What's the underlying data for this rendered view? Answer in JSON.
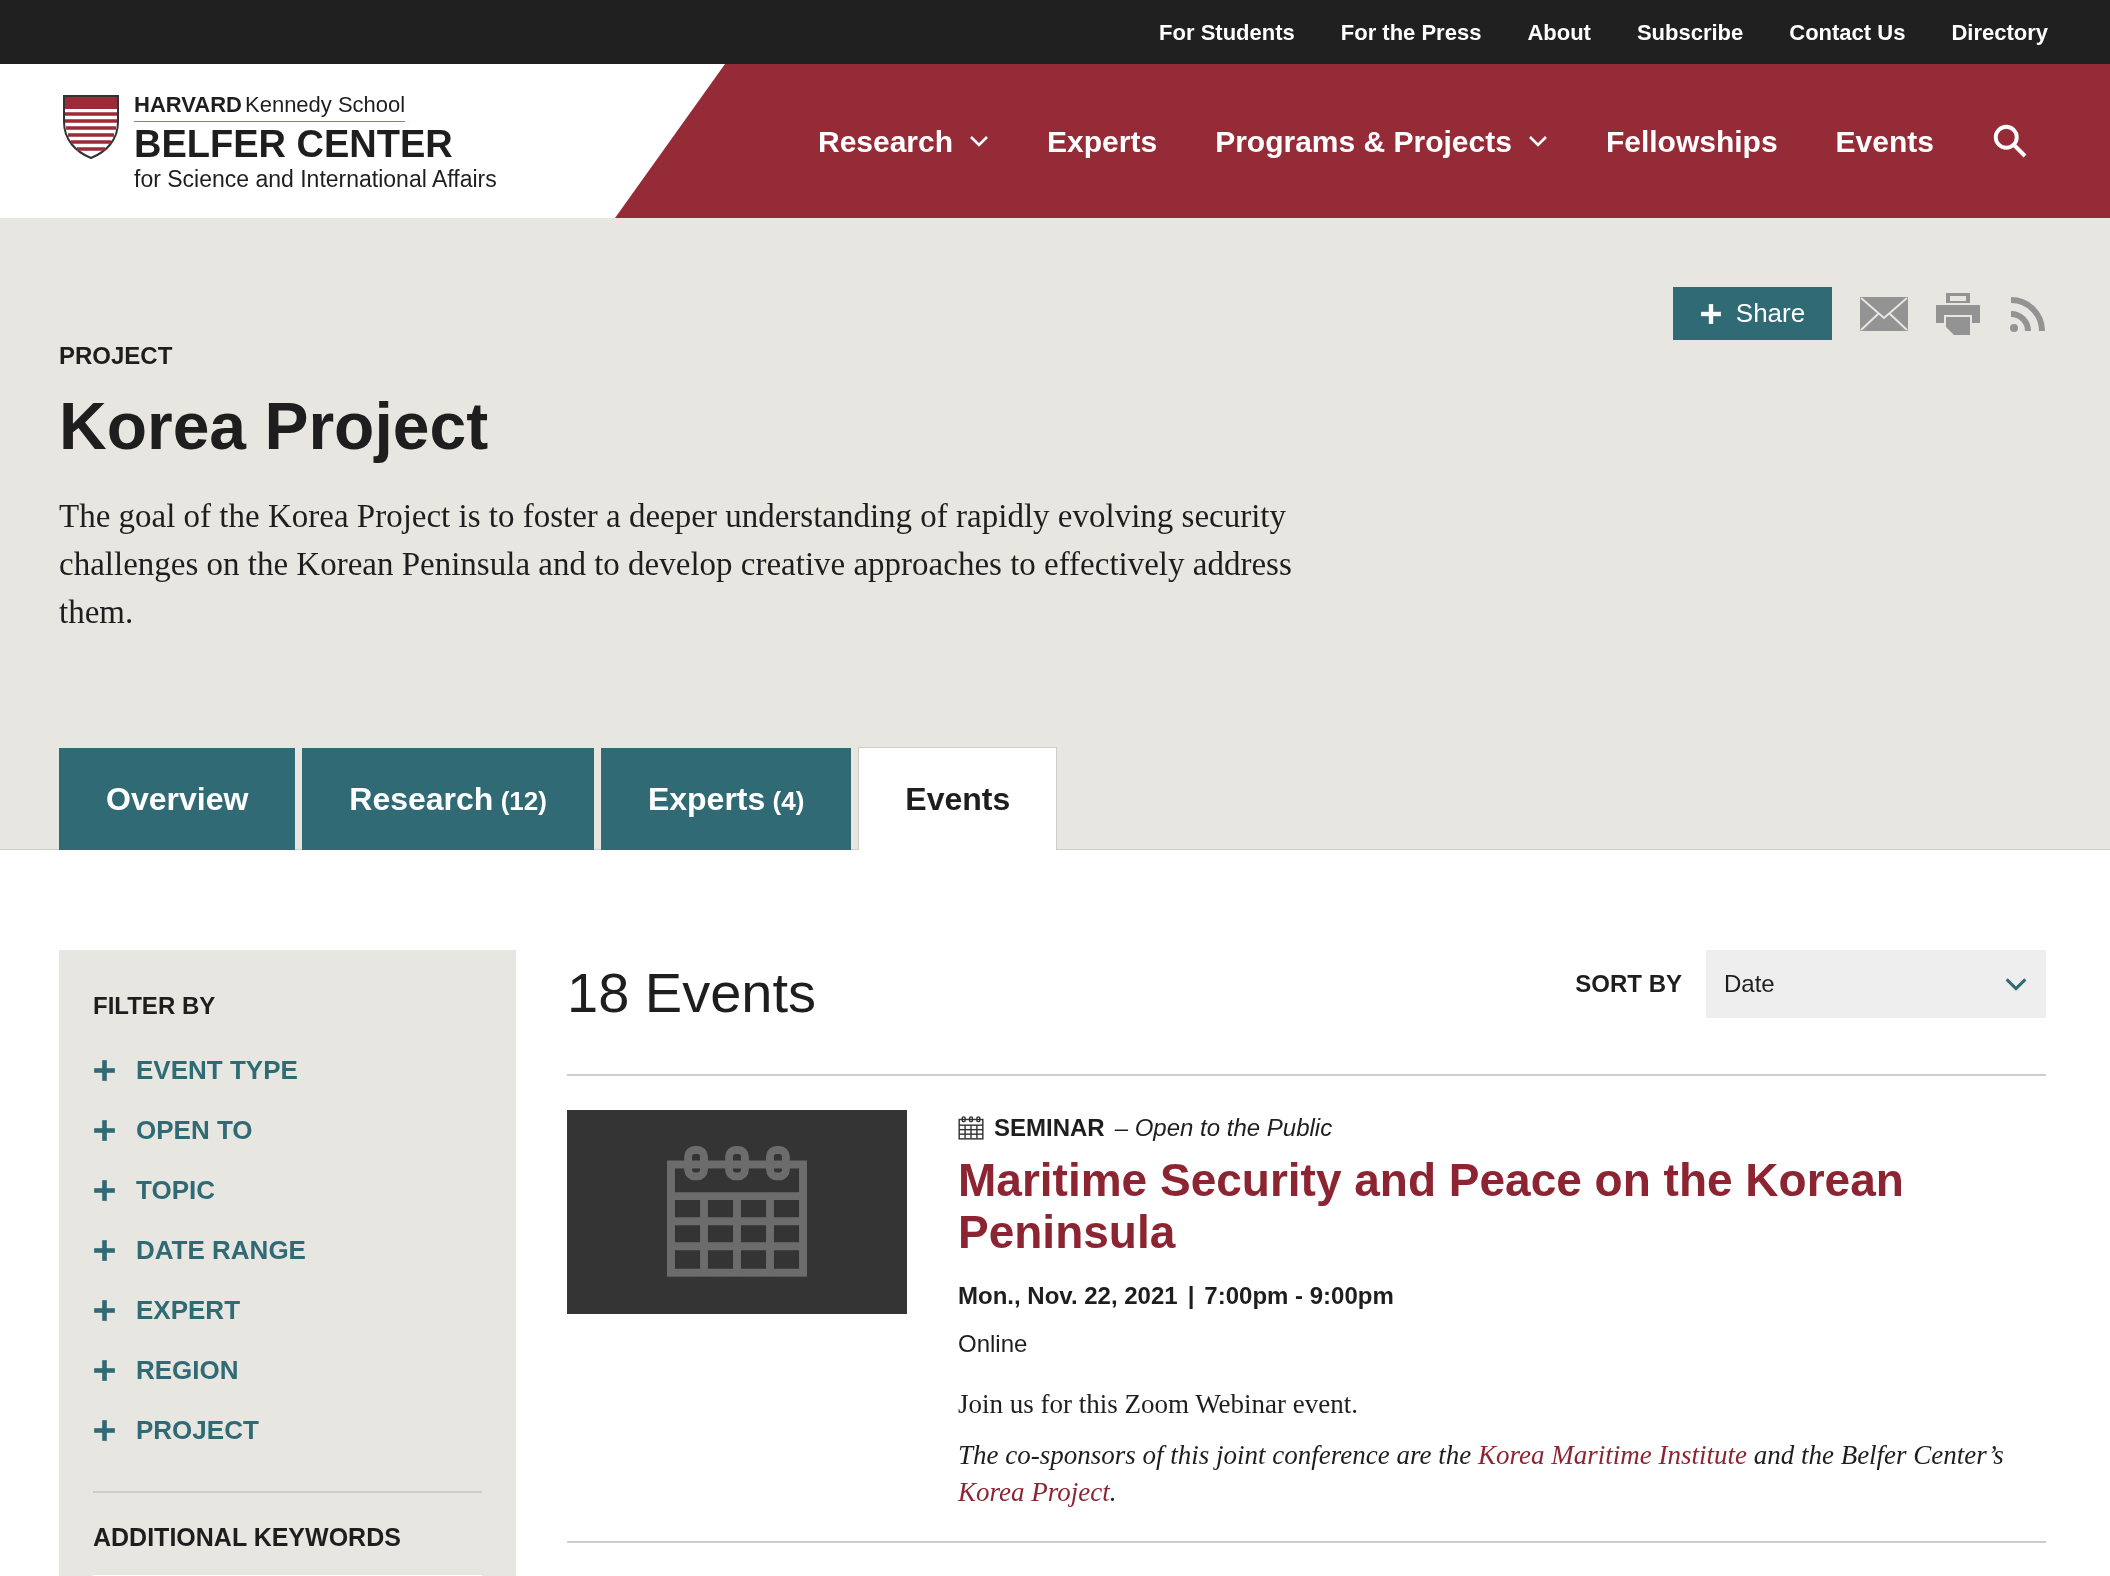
{
  "top_links": [
    "For Students",
    "For the Press",
    "About",
    "Subscribe",
    "Contact Us",
    "Directory"
  ],
  "logo": {
    "line_1_bold": "HARVARD",
    "line_1_rest": "Kennedy School",
    "line_2": "BELFER CENTER",
    "line_3": "for Science and International Affairs"
  },
  "main_nav": [
    {
      "label": "Research",
      "has_menu": true
    },
    {
      "label": "Experts",
      "has_menu": false
    },
    {
      "label": "Programs & Projects",
      "has_menu": true
    },
    {
      "label": "Fellowships",
      "has_menu": false
    },
    {
      "label": "Events",
      "has_menu": false
    }
  ],
  "share_button": "Share",
  "eyebrow": "PROJECT",
  "title": "Korea Project",
  "description": "The goal of the Korea Project is to foster a deeper understanding of rapidly evolving security challenges on the Korean Peninsula and to develop creative approaches to effectively address them.",
  "tabs": [
    {
      "label": "Overview",
      "selected": false
    },
    {
      "label": "Research",
      "count": "(12)",
      "selected": false
    },
    {
      "label": "Experts",
      "count": "(4)",
      "selected": false
    },
    {
      "label": "Events",
      "selected": true
    }
  ],
  "filters": {
    "heading": "FILTER BY",
    "items": [
      "EVENT TYPE",
      "OPEN TO",
      "TOPIC",
      "DATE RANGE",
      "EXPERT",
      "REGION",
      "PROJECT"
    ],
    "keywords_heading": "ADDITIONAL KEYWORDS"
  },
  "results": {
    "count": "18 Events",
    "sort_label": "SORT BY",
    "sort_value": "Date"
  },
  "events": [
    {
      "type": "SEMINAR",
      "audience": "– Open to the Public",
      "title": "Maritime Security and Peace on the Korean Peninsula",
      "date": "Mon., Nov. 22, 2021",
      "separator": "|",
      "time": "7:00pm - 9:00pm",
      "location": "Online",
      "summary": "Join us for this Zoom Webinar event.",
      "note": [
        {
          "kind": "text",
          "text": "The co-sponsors of this joint conference are the "
        },
        {
          "kind": "link",
          "text": "Korea Maritime Institute"
        },
        {
          "kind": "text",
          "text": " and the Belfer Center’s "
        },
        {
          "kind": "link",
          "text": "Korea Project"
        },
        {
          "kind": "text",
          "text": "."
        }
      ]
    }
  ]
}
